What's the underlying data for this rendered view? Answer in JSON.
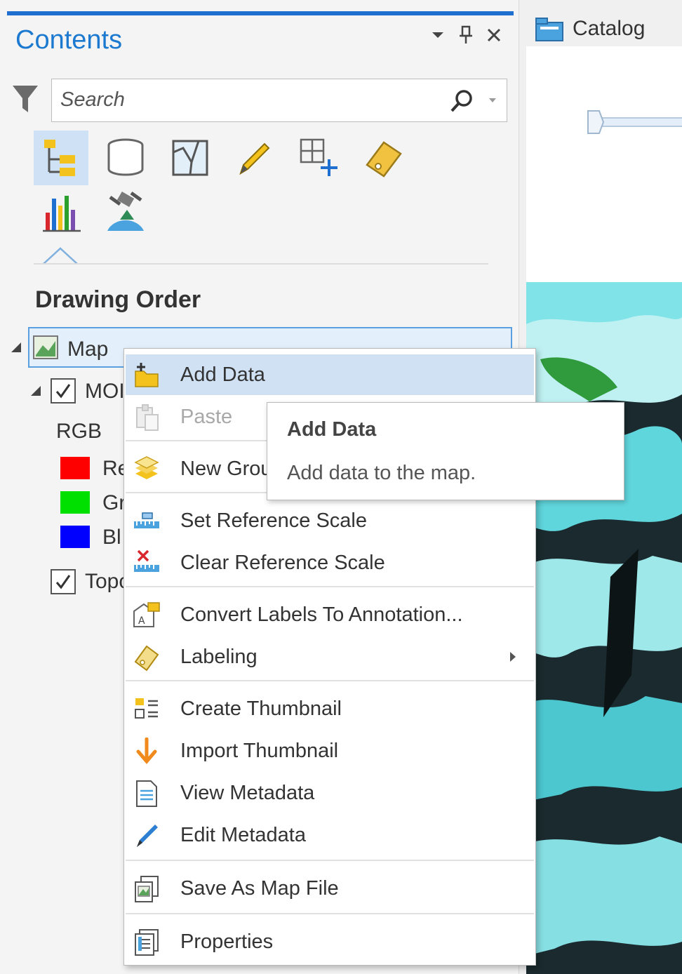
{
  "contents_pane": {
    "title": "Contents",
    "search": {
      "placeholder": "Search",
      "value": ""
    },
    "toolbar": {
      "buttons": [
        {
          "name": "list-by-drawing-order",
          "icon": "drawing-order-icon",
          "active": true
        },
        {
          "name": "list-by-data-source",
          "icon": "data-source-icon"
        },
        {
          "name": "list-by-selection",
          "icon": "selection-icon"
        },
        {
          "name": "list-by-editing",
          "icon": "editing-icon"
        },
        {
          "name": "list-by-snapping",
          "icon": "snapping-icon"
        },
        {
          "name": "list-by-labeling",
          "icon": "labeling-icon"
        },
        {
          "name": "list-charts",
          "icon": "charts-icon"
        },
        {
          "name": "list-perspective-imagery",
          "icon": "imagery-icon"
        }
      ]
    },
    "section_title": "Drawing Order",
    "tree": {
      "map": {
        "label": "Map"
      },
      "layer_1": {
        "label": "MOI",
        "checked": true
      },
      "rgb_label": "RGB",
      "bands": [
        {
          "label": "Re",
          "color": "#ff0000"
        },
        {
          "label": "Gr",
          "color": "#00e000"
        },
        {
          "label": "Bl",
          "color": "#0000ff"
        }
      ],
      "layer_2": {
        "label": "Topo",
        "checked": true
      }
    }
  },
  "catalog": {
    "label": "Catalog"
  },
  "context_menu": {
    "items": [
      {
        "label": "Add Data",
        "icon": "add-data-icon",
        "highlighted": true
      },
      {
        "label": "Paste",
        "icon": "paste-icon",
        "disabled": true
      },
      {
        "label": "New Group",
        "icon": "new-group-icon"
      },
      {
        "label": "Set Reference Scale",
        "icon": "set-reference-scale-icon"
      },
      {
        "label": "Clear Reference Scale",
        "icon": "clear-reference-scale-icon"
      },
      {
        "label": "Convert Labels To Annotation...",
        "icon": "convert-labels-icon"
      },
      {
        "label": "Labeling",
        "icon": "labeling-icon",
        "submenu": true
      },
      {
        "label": "Create Thumbnail",
        "icon": "create-thumbnail-icon"
      },
      {
        "label": "Import Thumbnail",
        "icon": "import-thumbnail-icon"
      },
      {
        "label": "View Metadata",
        "icon": "view-metadata-icon"
      },
      {
        "label": "Edit Metadata",
        "icon": "edit-metadata-icon"
      },
      {
        "label": "Save As Map File",
        "icon": "save-map-file-icon"
      },
      {
        "label": "Properties",
        "icon": "properties-icon"
      }
    ]
  },
  "tooltip": {
    "title": "Add Data",
    "description": "Add data to the map."
  },
  "colors": {
    "accent": "#1f6fd1",
    "title_blue": "#1c79d0",
    "highlight": "#cfe1f3"
  }
}
